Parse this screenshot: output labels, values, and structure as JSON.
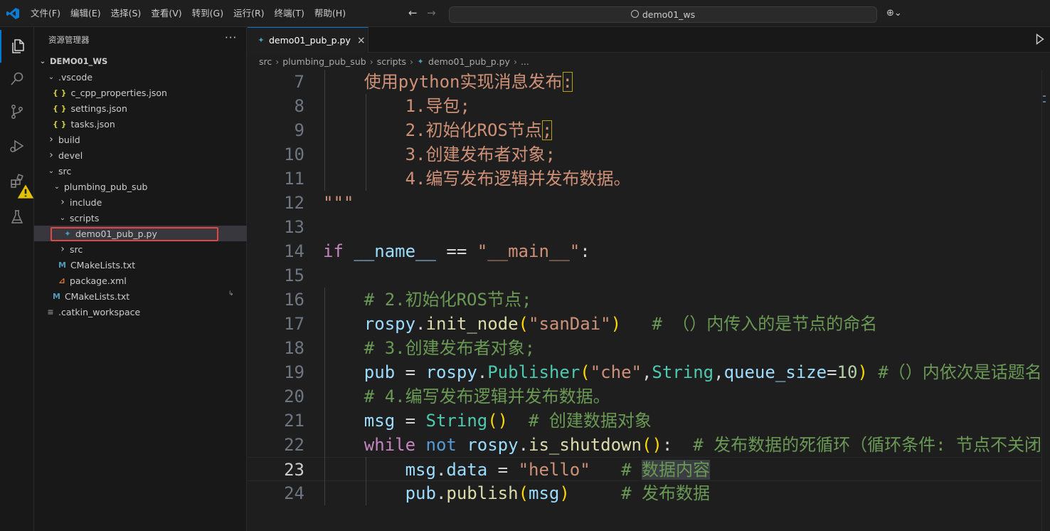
{
  "titlebar": {
    "menu": [
      "文件(F)",
      "编辑(E)",
      "选择(S)",
      "查看(V)",
      "转到(G)",
      "运行(R)",
      "终端(T)",
      "帮助(H)"
    ],
    "search_text": "demo01_ws",
    "back": "←",
    "forward": "→",
    "copilot": "⊕⌄"
  },
  "sidebar": {
    "title": "资源管理器",
    "more": "···",
    "workspace": "DEMO01_WS",
    "tree": [
      {
        "label": ".vscode",
        "depth": 1,
        "chevron": "v",
        "icon": ""
      },
      {
        "label": "c_cpp_properties.json",
        "depth": 2,
        "chevron": "",
        "icon": "{}"
      },
      {
        "label": "settings.json",
        "depth": 2,
        "chevron": "",
        "icon": "{}"
      },
      {
        "label": "tasks.json",
        "depth": 2,
        "chevron": "",
        "icon": "{}"
      },
      {
        "label": "build",
        "depth": 1,
        "chevron": ">",
        "icon": ""
      },
      {
        "label": "devel",
        "depth": 1,
        "chevron": ">",
        "icon": ""
      },
      {
        "label": "src",
        "depth": 1,
        "chevron": "v",
        "icon": ""
      },
      {
        "label": "plumbing_pub_sub",
        "depth": 2,
        "chevron": "v",
        "icon": ""
      },
      {
        "label": "include",
        "depth": 3,
        "chevron": ">",
        "icon": ""
      },
      {
        "label": "scripts",
        "depth": 3,
        "chevron": "v",
        "icon": ""
      },
      {
        "label": "demo01_pub_p.py",
        "depth": 4,
        "chevron": "",
        "icon": "py"
      },
      {
        "label": "src",
        "depth": 3,
        "chevron": ">",
        "icon": ""
      },
      {
        "label": "CMakeLists.txt",
        "depth": 3,
        "chevron": "",
        "icon": "M"
      },
      {
        "label": "package.xml",
        "depth": 3,
        "chevron": "",
        "icon": "rss"
      },
      {
        "label": "CMakeLists.txt",
        "depth": 2,
        "chevron": "",
        "icon": "M"
      },
      {
        "label": ".catkin_workspace",
        "depth": 1,
        "chevron": "",
        "icon": "≡"
      }
    ]
  },
  "editor": {
    "tab_label": "demo01_pub_p.py",
    "tab_close": "×",
    "breadcrumb": [
      "src",
      "plumbing_pub_sub",
      "scripts",
      "demo01_pub_p.py",
      "..."
    ],
    "current_line": 23,
    "lines": [
      {
        "n": "7",
        "indent": 1,
        "tokens": [
          [
            "s",
            "使用python实现消息发布"
          ],
          [
            "s box",
            ":"
          ]
        ]
      },
      {
        "n": "8",
        "indent": 2,
        "tokens": [
          [
            "s",
            "1.导包;"
          ]
        ]
      },
      {
        "n": "9",
        "indent": 2,
        "tokens": [
          [
            "s",
            "2.初始化ROS节点"
          ],
          [
            "s box",
            ";"
          ]
        ]
      },
      {
        "n": "10",
        "indent": 2,
        "tokens": [
          [
            "s",
            "3.创建发布者对象;"
          ]
        ]
      },
      {
        "n": "11",
        "indent": 2,
        "tokens": [
          [
            "s",
            "4.编写发布逻辑并发布数据。"
          ]
        ]
      },
      {
        "n": "12",
        "indent": 0,
        "tokens": [
          [
            "s",
            "\"\"\""
          ]
        ]
      },
      {
        "n": "13",
        "indent": 0,
        "tokens": []
      },
      {
        "n": "14",
        "indent": 0,
        "tokens": [
          [
            "k",
            "if"
          ],
          [
            "op",
            " "
          ],
          [
            "v",
            "__name__"
          ],
          [
            "op",
            " == "
          ],
          [
            "s",
            "\"__main__\""
          ],
          [
            "op",
            ":"
          ]
        ]
      },
      {
        "n": "15",
        "indent": 0,
        "tokens": []
      },
      {
        "n": "16",
        "indent": 1,
        "tokens": [
          [
            "c",
            "# 2.初始化ROS节点;"
          ]
        ]
      },
      {
        "n": "17",
        "indent": 1,
        "tokens": [
          [
            "v",
            "rospy"
          ],
          [
            "op",
            "."
          ],
          [
            "f",
            "init_node"
          ],
          [
            "br",
            "("
          ],
          [
            "s",
            "\"sanDai\""
          ],
          [
            "br",
            ")"
          ],
          [
            "op",
            "   "
          ],
          [
            "c",
            "# （）内传入的是节点的命名"
          ]
        ]
      },
      {
        "n": "18",
        "indent": 1,
        "tokens": [
          [
            "c",
            "# 3.创建发布者对象;"
          ]
        ]
      },
      {
        "n": "19",
        "indent": 1,
        "tokens": [
          [
            "v",
            "pub"
          ],
          [
            "op",
            " = "
          ],
          [
            "v",
            "rospy"
          ],
          [
            "op",
            "."
          ],
          [
            "cl",
            "Publisher"
          ],
          [
            "br",
            "("
          ],
          [
            "s",
            "\"che\""
          ],
          [
            "op",
            ","
          ],
          [
            "cl",
            "String"
          ],
          [
            "op",
            ","
          ],
          [
            "v",
            "queue_size"
          ],
          [
            "op",
            "="
          ],
          [
            "n",
            "10"
          ],
          [
            "br",
            ")"
          ],
          [
            "op",
            " "
          ],
          [
            "c",
            "#（）内依次是话题名称"
          ]
        ]
      },
      {
        "n": "20",
        "indent": 1,
        "tokens": [
          [
            "c",
            "# 4.编写发布逻辑并发布数据。"
          ]
        ]
      },
      {
        "n": "21",
        "indent": 1,
        "tokens": [
          [
            "v",
            "msg"
          ],
          [
            "op",
            " = "
          ],
          [
            "cl",
            "String"
          ],
          [
            "br",
            "()"
          ],
          [
            "op",
            "  "
          ],
          [
            "c",
            "# 创建数据对象"
          ]
        ]
      },
      {
        "n": "22",
        "indent": 1,
        "tokens": [
          [
            "k",
            "while"
          ],
          [
            "op",
            " "
          ],
          [
            "kb",
            "not"
          ],
          [
            "op",
            " "
          ],
          [
            "v",
            "rospy"
          ],
          [
            "op",
            "."
          ],
          [
            "f",
            "is_shutdown"
          ],
          [
            "br",
            "()"
          ],
          [
            "op",
            ":  "
          ],
          [
            "c",
            "# 发布数据的死循环（循环条件: 节点不关闭）"
          ]
        ]
      },
      {
        "n": "23",
        "indent": 2,
        "tokens": [
          [
            "v",
            "msg"
          ],
          [
            "op",
            "."
          ],
          [
            "v",
            "data"
          ],
          [
            "op",
            " = "
          ],
          [
            "s",
            "\"hello\""
          ],
          [
            "op",
            "   "
          ],
          [
            "c",
            "# "
          ],
          [
            "c word-hl",
            "数据内容"
          ]
        ]
      },
      {
        "n": "24",
        "indent": 2,
        "tokens": [
          [
            "v",
            "pub"
          ],
          [
            "op",
            "."
          ],
          [
            "f",
            "publish"
          ],
          [
            "br",
            "("
          ],
          [
            "v",
            "msg"
          ],
          [
            "br",
            ")"
          ],
          [
            "op",
            "     "
          ],
          [
            "c",
            "# 发布数据"
          ]
        ]
      }
    ]
  },
  "colors": {
    "accent": "#0078d4",
    "highlight_box": "#e04848",
    "warning": "#e2c100"
  }
}
